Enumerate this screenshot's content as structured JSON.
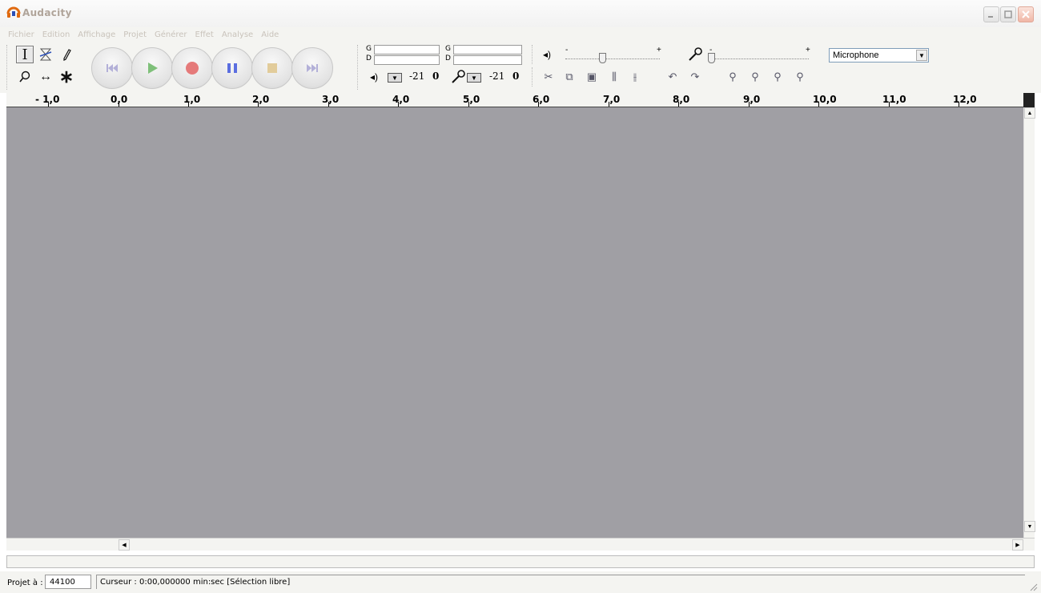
{
  "window": {
    "title": "Audacity"
  },
  "menu": [
    "Fichier",
    "Edition",
    "Affichage",
    "Projet",
    "Générer",
    "Effet",
    "Analyse",
    "Aide"
  ],
  "tools": {
    "row1": [
      "selection-tool",
      "envelope-tool",
      "draw-tool"
    ],
    "row2": [
      "zoom-tool",
      "timeshift-tool",
      "multi-tool"
    ]
  },
  "transport": [
    "skip-start",
    "play",
    "record",
    "pause",
    "stop",
    "skip-end"
  ],
  "meters": {
    "playback": {
      "left_label": "G",
      "right_label": "D",
      "db_min": "-21",
      "db_max": "0"
    },
    "record": {
      "left_label": "G",
      "right_label": "D",
      "db_min": "-21",
      "db_max": "0"
    }
  },
  "mixer": {
    "minus": "-",
    "plus": "+"
  },
  "input_select": {
    "value": "Microphone"
  },
  "ruler": {
    "labels": [
      "- 1,0",
      "0,0",
      "1,0",
      "2,0",
      "3,0",
      "4,0",
      "5,0",
      "6,0",
      "7,0",
      "8,0",
      "9,0",
      "10,0",
      "11,0",
      "12,0"
    ]
  },
  "status": {
    "rate_label": "Projet à :",
    "rate_value": "44100",
    "cursor_text": "Curseur : 0:00,000000 min:sec  [Sélection libre]"
  }
}
